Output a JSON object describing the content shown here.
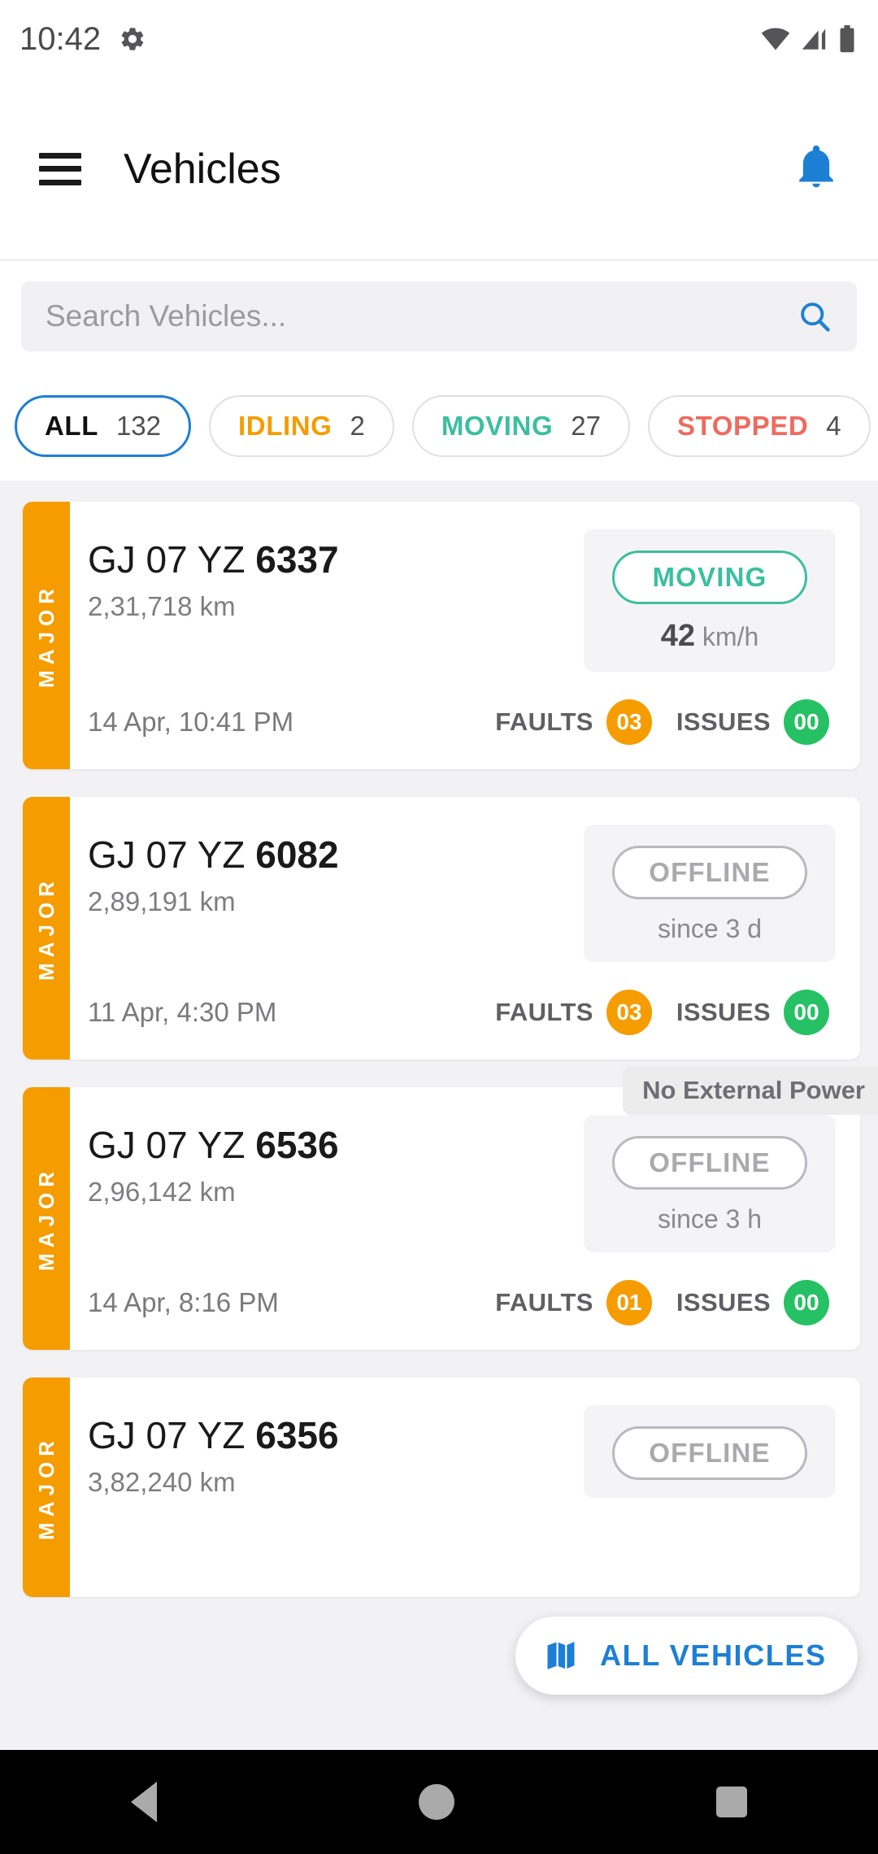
{
  "status_bar": {
    "time": "10:42",
    "icons": [
      "gear-icon",
      "wifi-icon",
      "signal-icon",
      "battery-icon"
    ]
  },
  "app_bar": {
    "menu_icon": "hamburger-menu-icon",
    "title": "Vehicles",
    "notification_icon": "bell-icon"
  },
  "search": {
    "placeholder": "Search Vehicles...",
    "value": "",
    "icon": "search-icon"
  },
  "filters": [
    {
      "label": "ALL",
      "count": "132",
      "color": "#111111",
      "selected": true
    },
    {
      "label": "IDLING",
      "count": "2",
      "color": "#f59c00",
      "selected": false
    },
    {
      "label": "MOVING",
      "count": "27",
      "color": "#3bbfa0",
      "selected": false
    },
    {
      "label": "STOPPED",
      "count": "4",
      "color": "#ef6a5e",
      "selected": false
    }
  ],
  "vehicles": [
    {
      "severity": "MAJOR",
      "plate_prefix": "GJ 07 YZ ",
      "plate_number": "6337",
      "odometer": "2,31,718 km",
      "status": "MOVING",
      "status_type": "moving",
      "speed_value": "42",
      "speed_unit": " km/h",
      "timestamp": "14 Apr, 10:41 PM",
      "faults_label": "FAULTS",
      "faults_count": "03",
      "issues_label": "ISSUES",
      "issues_count": "00",
      "tag": ""
    },
    {
      "severity": "MAJOR",
      "plate_prefix": "GJ 07 YZ ",
      "plate_number": "6082",
      "odometer": "2,89,191 km",
      "status": "OFFLINE",
      "status_type": "offline",
      "speed_value": "",
      "speed_unit": "since 3 d",
      "timestamp": "11 Apr, 4:30 PM",
      "faults_label": "FAULTS",
      "faults_count": "03",
      "issues_label": "ISSUES",
      "issues_count": "00",
      "tag": ""
    },
    {
      "severity": "MAJOR",
      "plate_prefix": "GJ 07 YZ ",
      "plate_number": "6536",
      "odometer": "2,96,142 km",
      "status": "OFFLINE",
      "status_type": "offline",
      "speed_value": "",
      "speed_unit": "since 3 h",
      "timestamp": "14 Apr, 8:16 PM",
      "faults_label": "FAULTS",
      "faults_count": "01",
      "issues_label": "ISSUES",
      "issues_count": "00",
      "tag": "No External Power"
    },
    {
      "severity": "MAJOR",
      "plate_prefix": "GJ 07 YZ ",
      "plate_number": "6356",
      "odometer": "3,82,240 km",
      "status": "OFFLINE",
      "status_type": "offline",
      "speed_value": "",
      "speed_unit": "",
      "timestamp": "",
      "faults_label": "",
      "faults_count": "",
      "issues_label": "",
      "issues_count": "",
      "tag": ""
    }
  ],
  "fab": {
    "icon": "map-icon",
    "label": "ALL VEHICLES"
  },
  "nav_bar": {
    "back": "back-icon",
    "home": "home-icon",
    "recents": "recents-icon"
  },
  "colors": {
    "accent_blue": "#1c7fd4",
    "severity_orange": "#f59c00",
    "moving_green": "#3bbfa0",
    "issues_green": "#26c164",
    "stopped_red": "#ef6a5e"
  }
}
